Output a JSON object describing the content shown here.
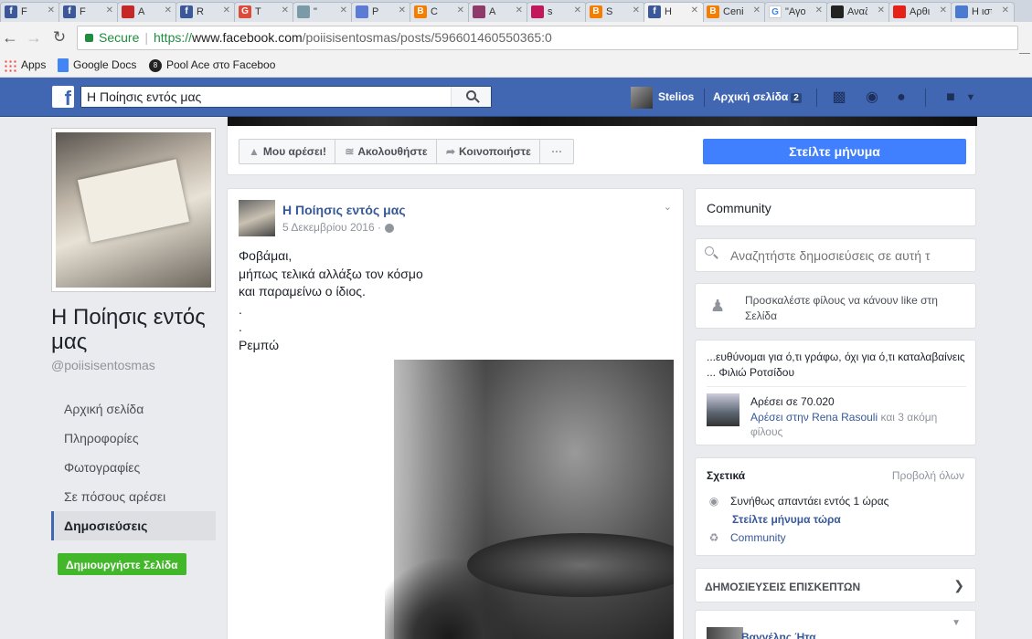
{
  "browser": {
    "tabs": [
      {
        "icon": "facebook-icon",
        "title": "F",
        "color": "#3b5998",
        "glyph": "f"
      },
      {
        "icon": "facebook-icon",
        "title": "F",
        "color": "#3b5998",
        "glyph": "f"
      },
      {
        "icon": "bookmark-icon",
        "title": "A",
        "color": "#c62828",
        "glyph": ""
      },
      {
        "icon": "facebook-icon",
        "title": "R",
        "color": "#3b5998",
        "glyph": "f"
      },
      {
        "icon": "google-plus-icon",
        "title": "T",
        "color": "#dd4b39",
        "glyph": "G"
      },
      {
        "icon": "page-icon",
        "title": "\"",
        "color": "#7a9aa8",
        "glyph": ""
      },
      {
        "icon": "diamond-icon",
        "title": "P",
        "color": "#5b7bd5",
        "glyph": ""
      },
      {
        "icon": "blogger-icon",
        "title": "C",
        "color": "#f57d00",
        "glyph": "B"
      },
      {
        "icon": "photo-icon",
        "title": "A",
        "color": "#8e3a6b",
        "glyph": ""
      },
      {
        "icon": "flower-icon",
        "title": "s",
        "color": "#c2185b",
        "glyph": ""
      },
      {
        "icon": "blogger-icon",
        "title": "S",
        "color": "#f57d00",
        "glyph": "B"
      },
      {
        "icon": "facebook-icon",
        "title": "Η",
        "color": "#3b5998",
        "glyph": "f"
      },
      {
        "icon": "blogger-icon",
        "title": "Ceni",
        "color": "#f57d00",
        "glyph": "B"
      },
      {
        "icon": "google-icon",
        "title": "\"Αγο",
        "color": "#ffffff",
        "glyph": "G"
      },
      {
        "icon": "page-icon",
        "title": "Αναζ",
        "color": "#222222",
        "glyph": ""
      },
      {
        "icon": "youtube-icon",
        "title": "Αρθι",
        "color": "#e62117",
        "glyph": ""
      },
      {
        "icon": "shield-icon",
        "title": "Η ιστ",
        "color": "#4a7bd1",
        "glyph": ""
      }
    ],
    "active_tab": 11,
    "url": {
      "secure_label": "Secure",
      "protocol": "https://",
      "host": "www.facebook.com",
      "path": "/poiisisentosmas/posts/596601460550365:0"
    },
    "bookmarks": [
      {
        "label": "Apps"
      },
      {
        "label": "Google Docs"
      },
      {
        "label": "Pool Ace στο Faceboo"
      }
    ]
  },
  "fb": {
    "search_value": "Η Ποίησις εντός μας",
    "user_name": "Stelios",
    "home_label": "Αρχική σελίδα",
    "home_count": "2"
  },
  "page": {
    "name": "Η Ποίησις εντός μας",
    "handle": "@poiisisentosmas",
    "nav": [
      {
        "label": "Αρχική σελίδα"
      },
      {
        "label": "Πληροφορίες"
      },
      {
        "label": "Φωτογραφίες"
      },
      {
        "label": "Σε πόσους αρέσει"
      },
      {
        "label": "Δημοσιεύσεις",
        "active": true
      }
    ],
    "create_label": "Δημιουργήστε Σελίδα",
    "actions": {
      "like": "Μου αρέσει!",
      "follow": "Ακολουθήστε",
      "share": "Κοινοποιήστε",
      "more": "···",
      "message": "Στείλτε μήνυμα"
    }
  },
  "post": {
    "author": "Η Ποίησις εντός μας",
    "date": "5 Δεκεμβρίου 2016 ·",
    "lines": [
      "Φοβάμαι,",
      "μήπως τελικά αλλάξω τον κόσμο",
      "και παραμείνω ο ίδιος.",
      ".",
      ".",
      "Ρεμπώ"
    ]
  },
  "sidebar": {
    "community": "Community",
    "search_placeholder": "Αναζητήστε δημοσιεύσεις σε αυτή τ",
    "invite": "Προσκαλέστε φίλους να κάνουν like στη Σελίδα",
    "quote": "...ευθύνομαι για ό,τι γράφω, όχι για ό,τι καταλαβαίνεις ... Φιλιώ Ροτσίδου",
    "likes": "Αρέσει σε 70.020",
    "likes_friend_prefix": "Αρέσει στην Rena Rasouli",
    "likes_friend_suffix": " και 3 ακόμη φίλους",
    "about_title": "Σχετικά",
    "about_view_all": "Προβολή όλων",
    "response": "Συνήθως απαντάει εντός 1 ώρας",
    "send_now": "Στείλτε μήνυμα τώρα",
    "category": "Community",
    "visitor_posts": "ΔΗΜΟΣΙΕΥΣΕΙΣ ΕΠΙΣΚΕΠΤΩΝ",
    "visitor_name": "Βαγγέλης Ήτα"
  },
  "colors": {
    "fb_blue": "#4267b2",
    "link": "#365899",
    "send_btn": "#4080ff",
    "create_btn": "#42b72a",
    "secure_green": "#1e8e3e"
  }
}
